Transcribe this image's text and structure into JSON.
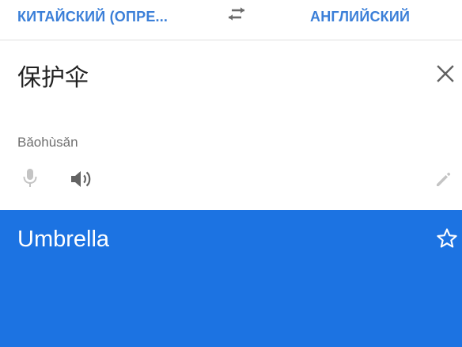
{
  "language_bar": {
    "source_language": "КИТАЙСКИЙ (ОПРЕ...",
    "target_language": "АНГЛИЙСКИЙ",
    "swap_icon": "swap-arrows-icon"
  },
  "input": {
    "source_text": "保护伞",
    "transliteration": "Bǎohùsǎn",
    "clear_icon": "close-icon",
    "mic_icon": "microphone-icon",
    "speaker_icon": "speaker-icon",
    "edit_icon": "pencil-icon"
  },
  "result": {
    "translated_text": "Umbrella",
    "star_icon": "star-outline-icon"
  },
  "colors": {
    "accent_text": "#3b7fd8",
    "result_background": "#1c73e2",
    "icon_gray": "#6b6b6b",
    "icon_disabled": "#bdbdbd"
  }
}
